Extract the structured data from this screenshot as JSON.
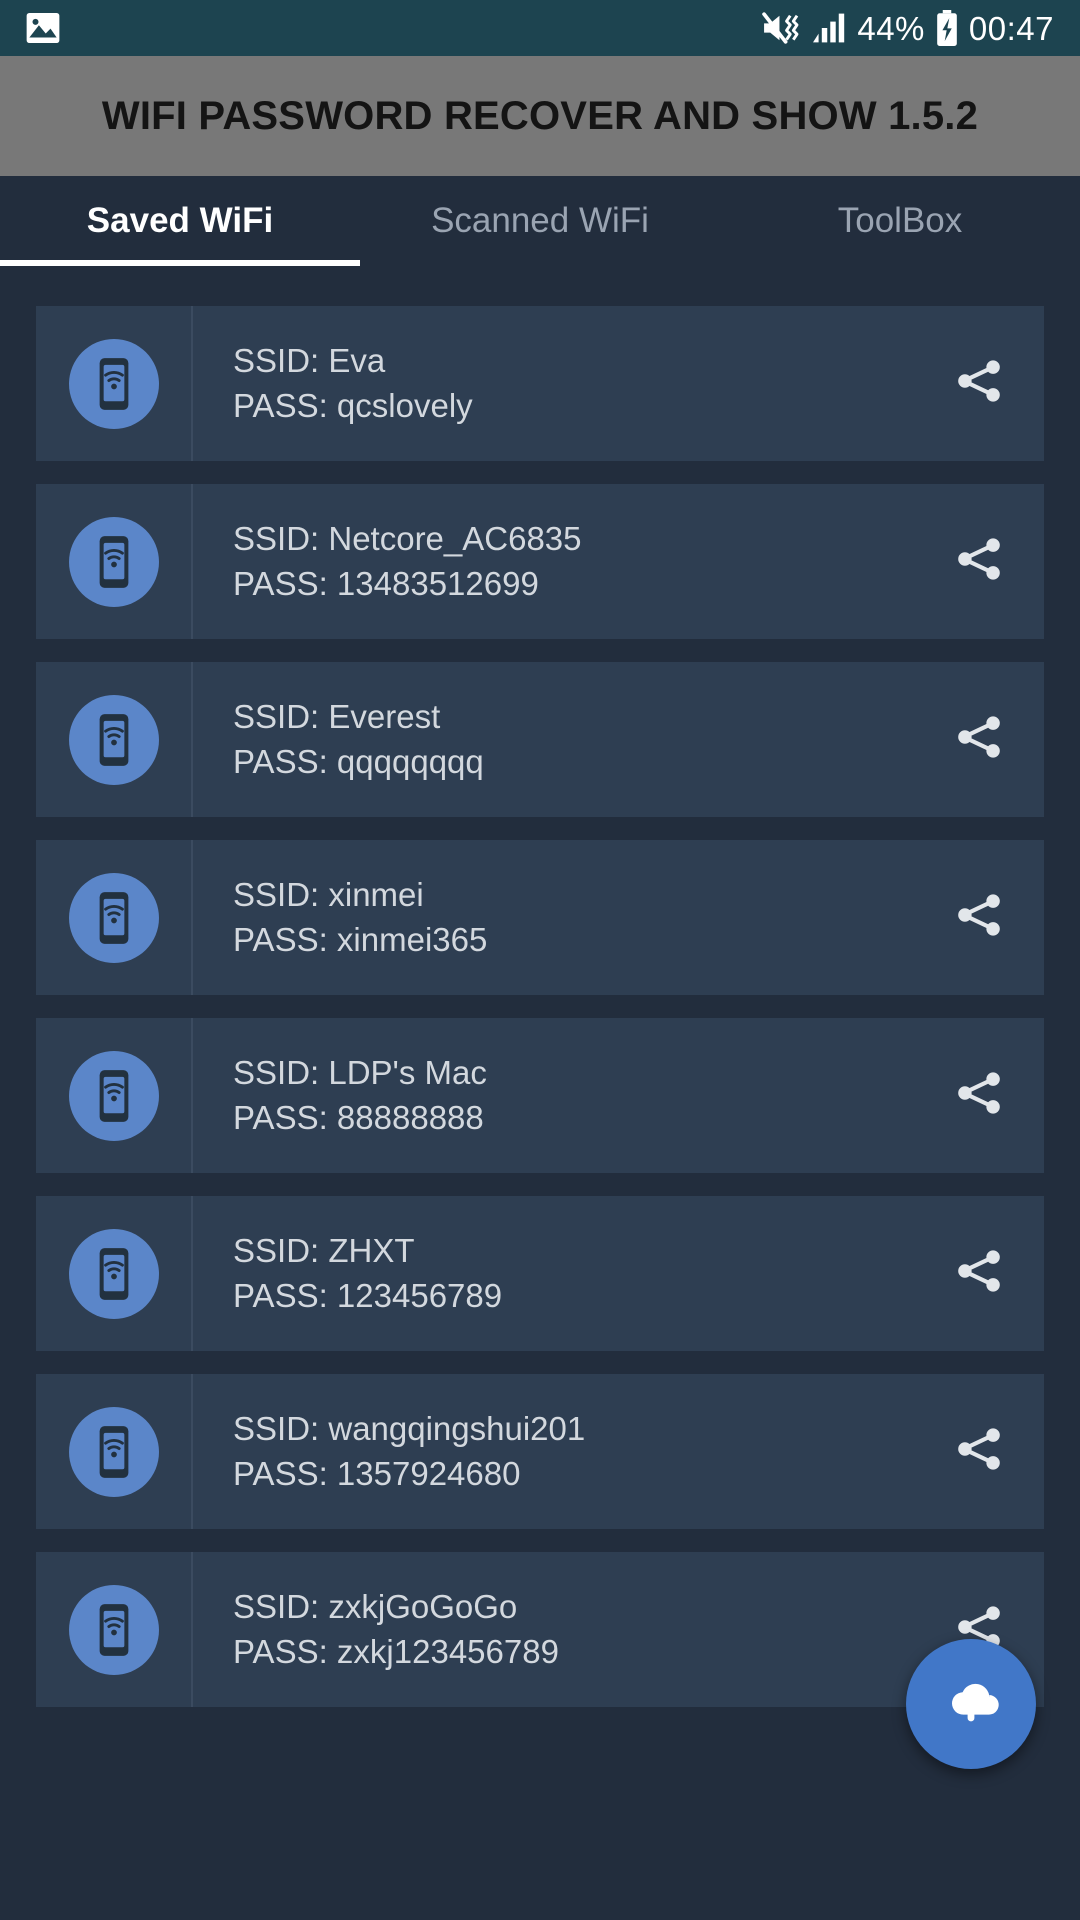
{
  "status_bar": {
    "photo_icon": "photo-icon",
    "mute_icon": "mute-vibrate-icon",
    "signal_icon": "signal-bars-icon",
    "battery_percent": "44%",
    "battery_icon": "battery-charging-icon",
    "time": "00:47",
    "background": "#1d4450"
  },
  "app_bar": {
    "title": "WIFI PASSWORD RECOVER AND SHOW 1.5.2",
    "background": "#787878",
    "text_color": "#141414"
  },
  "tabs": {
    "active_index": 0,
    "items": [
      {
        "label": "Saved WiFi"
      },
      {
        "label": "Scanned WiFi"
      },
      {
        "label": "ToolBox"
      }
    ],
    "active_color": "#ffffff",
    "inactive_color": "#9aa4b2"
  },
  "labels": {
    "ssid_prefix": "SSID:",
    "pass_prefix": "PASS:"
  },
  "list": {
    "card_background": "#2e3e52",
    "avatar_color": "#5b86c9",
    "items": [
      {
        "ssid": "SSID: Eva",
        "pass": "PASS: qcslovely",
        "icon": "phone-wifi-icon",
        "share": "share-icon"
      },
      {
        "ssid": "SSID: Netcore_AC6835",
        "pass": "PASS: 13483512699",
        "icon": "phone-wifi-icon",
        "share": "share-icon"
      },
      {
        "ssid": "SSID: Everest",
        "pass": "PASS: qqqqqqqq",
        "icon": "phone-wifi-icon",
        "share": "share-icon"
      },
      {
        "ssid": "SSID: xinmei",
        "pass": "PASS: xinmei365",
        "icon": "phone-wifi-icon",
        "share": "share-icon"
      },
      {
        "ssid": "SSID: LDP's Mac",
        "pass": "PASS: 88888888",
        "icon": "phone-wifi-icon",
        "share": "share-icon"
      },
      {
        "ssid": "SSID: ZHXT",
        "pass": "PASS: 123456789",
        "icon": "phone-wifi-icon",
        "share": "share-icon"
      },
      {
        "ssid": "SSID: wangqingshui201",
        "pass": "PASS: 1357924680",
        "icon": "phone-wifi-icon",
        "share": "share-icon"
      },
      {
        "ssid": "SSID: zxkjGoGoGo",
        "pass": "PASS: zxkj123456789",
        "icon": "phone-wifi-icon",
        "share": "share-icon"
      }
    ]
  },
  "fab": {
    "icon": "cloud-upload-icon",
    "color": "#4177c8"
  }
}
